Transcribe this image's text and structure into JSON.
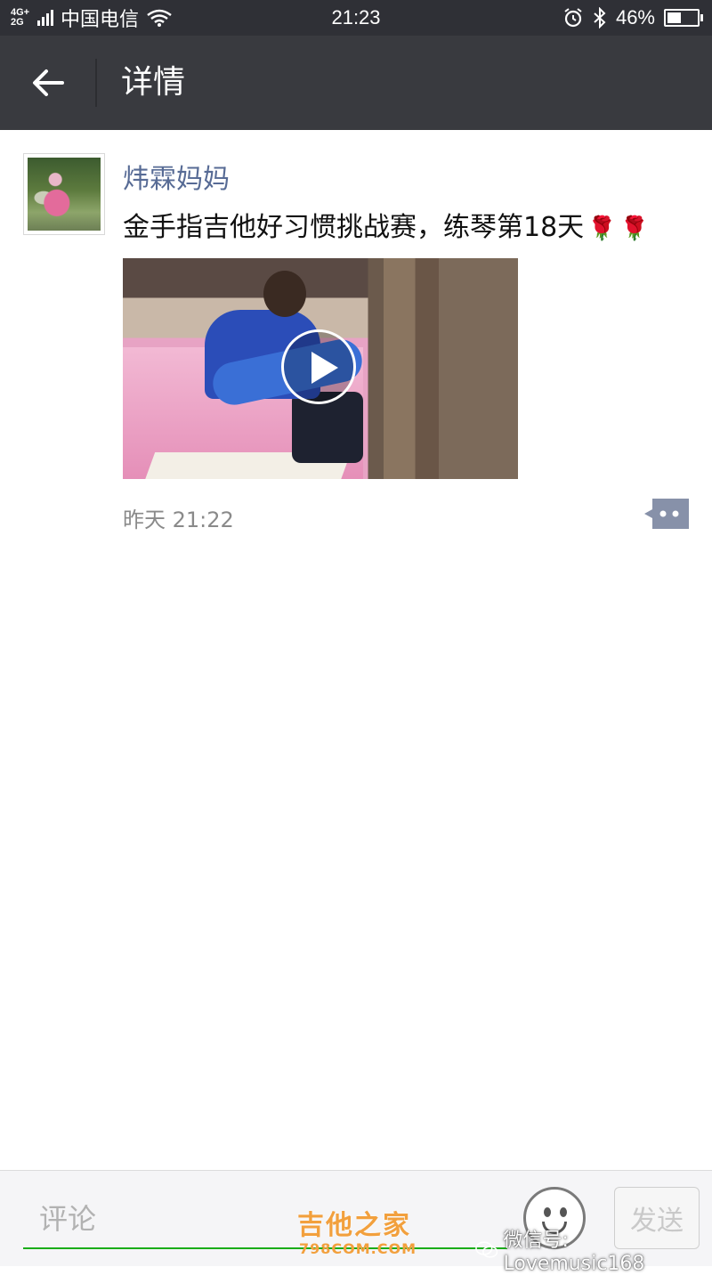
{
  "status_bar": {
    "network_type": "4G+ 2G",
    "carrier": "中国电信",
    "time": "21:23",
    "battery_percent": "46%",
    "battery_level": 0.46
  },
  "header": {
    "back_icon": "arrow-left-icon",
    "title": "详情"
  },
  "post": {
    "author": "炜霖妈妈",
    "text": "金手指吉他好习惯挑战赛，练琴第18天",
    "emoji": [
      "🌹",
      "🌹"
    ],
    "video": {
      "play_icon": "play-circle-icon"
    },
    "timestamp": "昨天 21:22",
    "more_icon": "comment-more-icon"
  },
  "comment_bar": {
    "placeholder": "评论",
    "emoji_icon": "smiley-icon",
    "send_label": "发送"
  },
  "watermark": {
    "logo_text": "吉他之家",
    "logo_sub": "798COM.COM",
    "account": "微信号: Lovemusic168"
  },
  "colors": {
    "status_bar": "#2f3036",
    "title_bar": "#393a3f",
    "author_link": "#576b95",
    "input_underline": "#1aad19",
    "more_button": "#8791a9"
  }
}
